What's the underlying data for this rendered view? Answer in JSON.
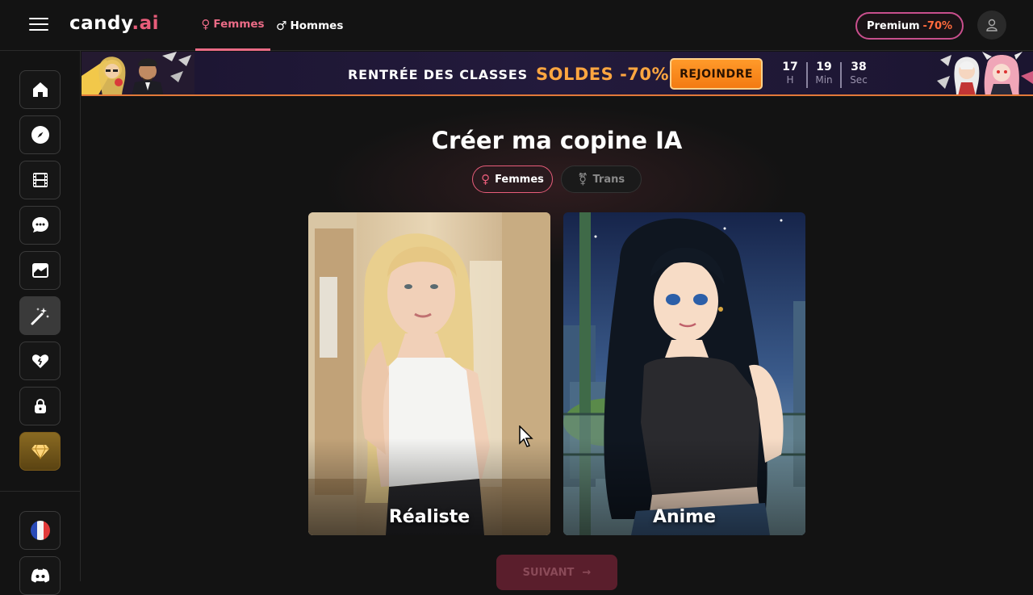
{
  "header": {
    "logo_main": "candy",
    "logo_dot": ".ai",
    "tabs": [
      {
        "label": "Femmes",
        "icon": "female-icon",
        "symbol": "♀",
        "active": true
      },
      {
        "label": "Hommes",
        "icon": "male-icon",
        "symbol": "♂",
        "active": false
      }
    ],
    "premium_label": "Premium",
    "premium_discount": "-70%"
  },
  "sidebar": {
    "items": [
      {
        "name": "home",
        "icon": "home-icon"
      },
      {
        "name": "explore",
        "icon": "compass-icon"
      },
      {
        "name": "videos",
        "icon": "film-icon"
      },
      {
        "name": "chat",
        "icon": "chat-icon"
      },
      {
        "name": "gallery",
        "icon": "image-icon"
      },
      {
        "name": "create",
        "icon": "magic-wand-icon",
        "active": true
      },
      {
        "name": "my-ai",
        "icon": "heart-icon"
      },
      {
        "name": "private",
        "icon": "lock-icon"
      },
      {
        "name": "premium",
        "icon": "diamond-icon"
      }
    ],
    "bottom": [
      {
        "name": "language",
        "icon": "france-flag-icon"
      },
      {
        "name": "discord",
        "icon": "discord-icon"
      }
    ]
  },
  "banner": {
    "text": "RENTRÉE DES CLASSES",
    "sale": "SOLDES -70%",
    "button": "REJOINDRE",
    "countdown": [
      {
        "value": "17",
        "unit": "H"
      },
      {
        "value": "19",
        "unit": "Min"
      },
      {
        "value": "38",
        "unit": "Sec"
      }
    ]
  },
  "main": {
    "title": "Créer ma copine IA",
    "filters": [
      {
        "label": "Femmes",
        "symbol": "♀",
        "active": true
      },
      {
        "label": "Trans",
        "symbol": "⚧",
        "active": false
      }
    ],
    "cards": [
      {
        "label": "Réaliste"
      },
      {
        "label": "Anime"
      }
    ],
    "next_button": "SUIVANT",
    "next_arrow": "→"
  },
  "colors": {
    "accent": "#e85d7a",
    "background": "#131313",
    "banner_orange": "#f37a12"
  }
}
